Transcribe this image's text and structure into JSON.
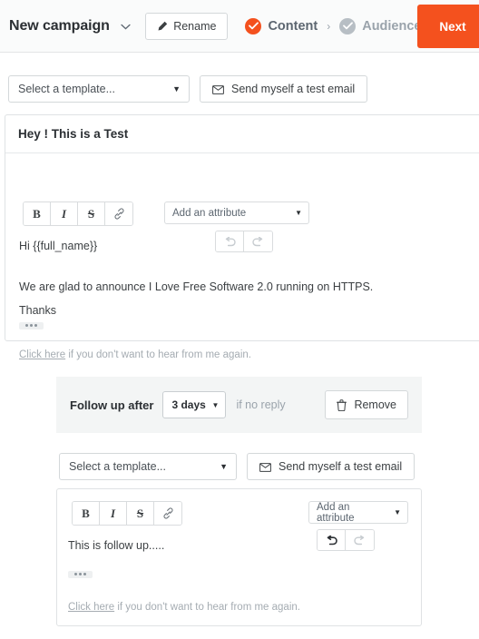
{
  "header": {
    "campaign_name": "New campaign",
    "caret_icon": "chevron-down-icon",
    "rename_label": "Rename",
    "rename_icon": "pencil-icon",
    "steps": [
      {
        "label": "Content",
        "state": "active",
        "icon": "check-circle-icon"
      },
      {
        "label": "Audience",
        "state": "inactive",
        "icon": "check-circle-icon"
      }
    ],
    "step_separator": "›",
    "next_label": "Next",
    "accent_color": "#f4511e",
    "inactive_color": "#b7bec4"
  },
  "email1": {
    "template_select": {
      "value": "Select a template...",
      "caret": "▼"
    },
    "test_email_label": "Send myself a test email",
    "test_email_icon": "envelope-icon",
    "subject": "Hey ! This is a Test",
    "toolbar": {
      "bold": "B",
      "italic": "I",
      "strikethrough": "S",
      "link_icon": "link-icon",
      "attribute_select": {
        "value": "Add an attribute",
        "caret": "▼"
      },
      "undo_icon": "undo-icon",
      "redo_icon": "redo-icon",
      "undo_enabled": false,
      "redo_enabled": false
    },
    "body": [
      "Hi {{full_name}}",
      "We are glad to announce I Love Free Software 2.0 running on HTTPS.",
      "Thanks"
    ],
    "signature_chip": "dots-icon",
    "unsubscribe": {
      "link_text": "Click here",
      "rest_text": " if you don't want to hear from me again."
    }
  },
  "followup": {
    "label": "Follow up after",
    "days_select": {
      "value": "3 days",
      "caret": "▼"
    },
    "condition": "if no reply",
    "remove_label": "Remove",
    "remove_icon": "trash-icon"
  },
  "email2": {
    "template_select": {
      "value": "Select a template...",
      "caret": "▼"
    },
    "test_email_label": "Send myself a test email",
    "test_email_icon": "envelope-icon",
    "toolbar": {
      "bold": "B",
      "italic": "I",
      "strikethrough": "S",
      "link_icon": "link-icon",
      "attribute_select": {
        "value": "Add an attribute",
        "caret": "▼"
      },
      "undo_icon": "undo-icon",
      "redo_icon": "redo-icon",
      "undo_enabled": true,
      "redo_enabled": false
    },
    "body": [
      "This is follow up....."
    ],
    "signature_chip": "dots-icon",
    "unsubscribe": {
      "link_text": "Click here",
      "rest_text": " if you don't want to hear from me again."
    }
  }
}
